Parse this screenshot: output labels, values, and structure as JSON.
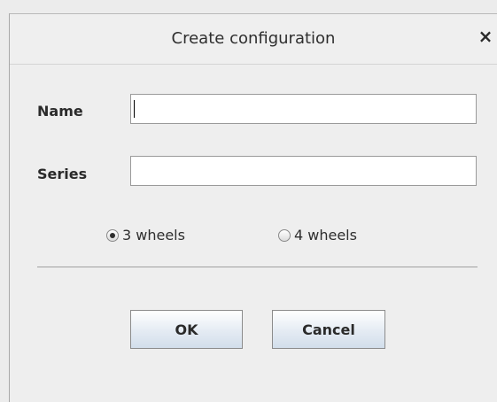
{
  "dialog": {
    "title": "Create configuration",
    "close_glyph": "×",
    "close_icon": "close-icon"
  },
  "form": {
    "name_label": "Name",
    "name_value": "",
    "series_label": "Series",
    "series_value": ""
  },
  "wheels": {
    "options": [
      {
        "label": "3 wheels",
        "selected": true
      },
      {
        "label": "4 wheels",
        "selected": false
      }
    ]
  },
  "buttons": {
    "ok_label": "OK",
    "cancel_label": "Cancel"
  }
}
